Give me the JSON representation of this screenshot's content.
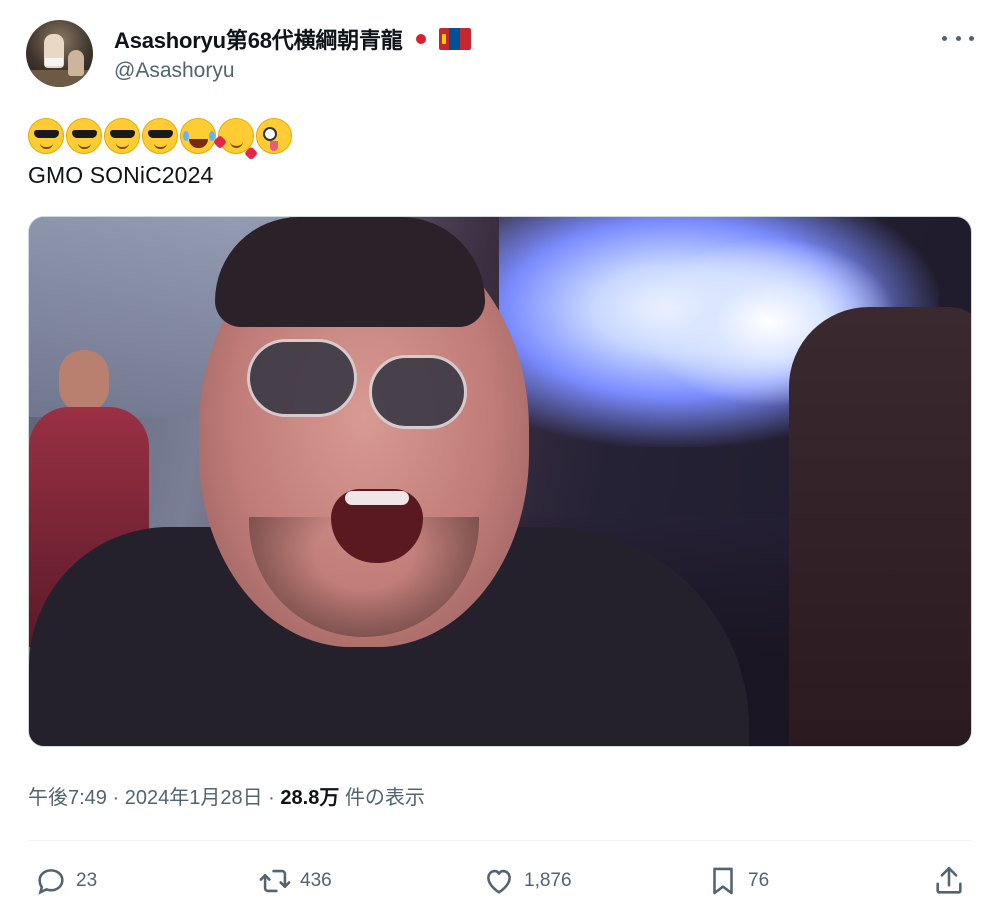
{
  "author": {
    "display_name": "Asashoryu第68代横綱朝青龍",
    "handle": "@Asashoryu",
    "flags": [
      "japan-flag",
      "mongolia-flag"
    ]
  },
  "tweet": {
    "emojis": [
      "sunglasses",
      "sunglasses",
      "sunglasses",
      "sunglasses",
      "tears-of-joy",
      "smiling-with-hearts",
      "zany-face"
    ],
    "text": "GMO SONiC2024"
  },
  "meta": {
    "time": "午後7:49",
    "separator": "·",
    "date": "2024年1月28日",
    "views_count": "28.8万",
    "views_label": "件の表示"
  },
  "actions": {
    "replies": "23",
    "retweets": "436",
    "likes": "1,876",
    "bookmarks": "76"
  },
  "colors": {
    "text_primary": "#0f1419",
    "text_secondary": "#536471",
    "divider": "#eff3f4"
  }
}
